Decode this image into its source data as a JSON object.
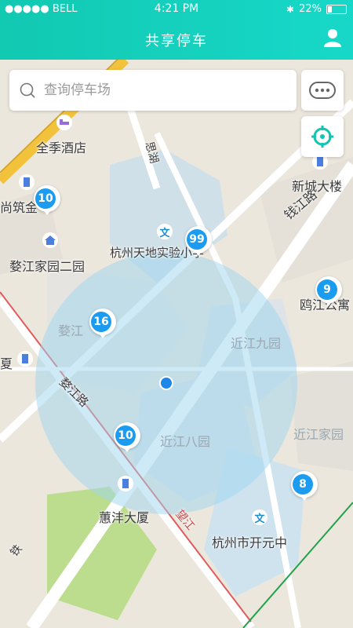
{
  "status_bar": {
    "carrier": "●●●●● BELL",
    "time": "4:21 PM",
    "battery": "22%"
  },
  "header": {
    "title": "共享停车"
  },
  "search": {
    "placeholder": "查询停车场"
  },
  "colors": {
    "header": "#14CDB9",
    "marker": "#1B9CF0",
    "radius": "#9ED6F0"
  },
  "map": {
    "labels": {
      "hotel": "全季酒店",
      "tower": "新城大楼",
      "apartment_left": "尚筑金",
      "garden_two": "婺江家园二园",
      "school": "杭州天地实验小学",
      "road_qianjiang": "钱江路",
      "road_sihe": "思湖",
      "river_west": "婺江",
      "ou_east": "鸥江公寓",
      "xia": "夏",
      "jiuyuan": "近江九园",
      "bayuan": "近江八园",
      "jiayuan": "近江家园",
      "road_wujiang": "婺江路",
      "huifeng": "蕙沣大厦",
      "kaiyuan": "杭州市开元中",
      "road_bottom": "铁",
      "road_wanghe": "望江"
    },
    "markers": [
      {
        "count": "10",
        "name": "marker-shangzhu"
      },
      {
        "count": "99",
        "name": "marker-school"
      },
      {
        "count": "9",
        "name": "marker-ou"
      },
      {
        "count": "16",
        "name": "marker-wujiang"
      },
      {
        "count": "10",
        "name": "marker-center"
      },
      {
        "count": "8",
        "name": "marker-kaiyuan"
      }
    ]
  }
}
